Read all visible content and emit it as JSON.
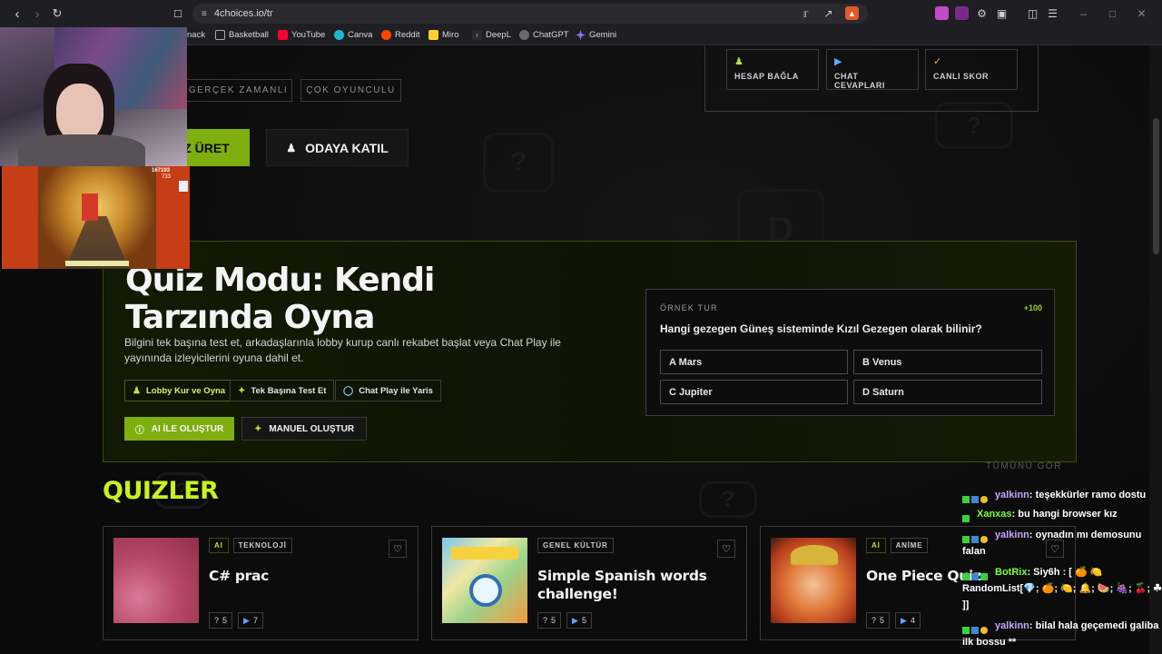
{
  "browser": {
    "url": "4choices.io/tr",
    "badge_count": "2"
  },
  "bookmarks": [
    {
      "label": "nack",
      "color": "#2f2f2f"
    },
    {
      "label": "Basketball",
      "color": "#3a3a3a"
    },
    {
      "label": "YouTube",
      "color": "#ff0033"
    },
    {
      "label": "Canva",
      "color": "#1fb6d4"
    },
    {
      "label": "Reddit",
      "color": "#ff4500"
    },
    {
      "label": "Miro",
      "color": "#ffd02f"
    },
    {
      "label": "DeepL",
      "color": "#2b2b2b"
    },
    {
      "label": "ChatGPT",
      "color": "#6a6a6a"
    },
    {
      "label": "Gemini",
      "color": "#4b7dff"
    }
  ],
  "hero": {
    "tags": [
      "GERÇEK ZAMANLI",
      "ÇOK OYUNCULU"
    ],
    "generate_button": "Z ÜRET",
    "join_button": "ODAYA KATIL"
  },
  "features": [
    {
      "label": "HESAP BAĞLA",
      "icon": "users-icon"
    },
    {
      "label": "CHAT CEVAPLARI",
      "icon": "play-circle-icon"
    },
    {
      "label": "CANLI SKOR",
      "icon": "check-circle-icon"
    }
  ],
  "quiz_mode": {
    "title_line1": "Quiz Modu: Kendi",
    "title_line2": "Tarzında Oyna",
    "description": "Bilgini tek başına test et, arkadaşlarınla lobby kurup canlı rekabet başlat veya Chat Play ile yayınında izleyicilerini oyuna dahil et.",
    "chips": [
      "Lobby Kur ve Oyna",
      "Tek Başına Test Et",
      "Chat Play ile Yaris"
    ],
    "ai_button": "AI İLE OLUŞTUR",
    "manual_button": "MANUEL OLUŞTUR",
    "example": {
      "label": "ÖRNEK TUR",
      "points": "+100",
      "question": "Hangi gezegen Güneş sisteminde Kızıl Gezegen olarak bilinir?",
      "options": [
        "A Mars",
        "B Venus",
        "C Jupiter",
        "D Saturn"
      ]
    }
  },
  "quizzes": {
    "title": "QUIZLER",
    "see_all": "TÜMÜNÜ GÖR",
    "cards": [
      {
        "title": "C# prac",
        "badges": [
          "AI",
          "TEKNOLOJİ"
        ],
        "questions": "5",
        "plays": "7"
      },
      {
        "title": "Simple Spanish words challenge!",
        "badges": [
          "GENEL KÜLTÜR"
        ],
        "questions": "5",
        "plays": "5"
      },
      {
        "title": "One Piece Quiz",
        "badges": [
          "AI",
          "ANİME"
        ],
        "questions": "5",
        "plays": "4"
      }
    ]
  },
  "overlay": {
    "game_score": "167193",
    "game_coins": "733"
  },
  "chat": [
    {
      "user": "yalkinn",
      "text": ": teşekkürler ramo dostu",
      "color": "#c7a6ff"
    },
    {
      "user": "Xanxas",
      "text": ": bu hangi browser kız",
      "color": "#7cff3a"
    },
    {
      "user": "yalkinn",
      "text": ": oynadın mı demosunu falan",
      "color": "#c7a6ff"
    },
    {
      "user": "BotRix",
      "text": ": Siy6h : [ 🍊 🍋 RandomList[💎; 🍊; 🍋; 🔔; 🍉; 🍇; 🍒; ☘ ]]",
      "color": "#7cff3a"
    },
    {
      "user": "yalkinn",
      "text": ": bilal hala geçemedi galiba ilk bossu **",
      "color": "#c7a6ff"
    }
  ]
}
